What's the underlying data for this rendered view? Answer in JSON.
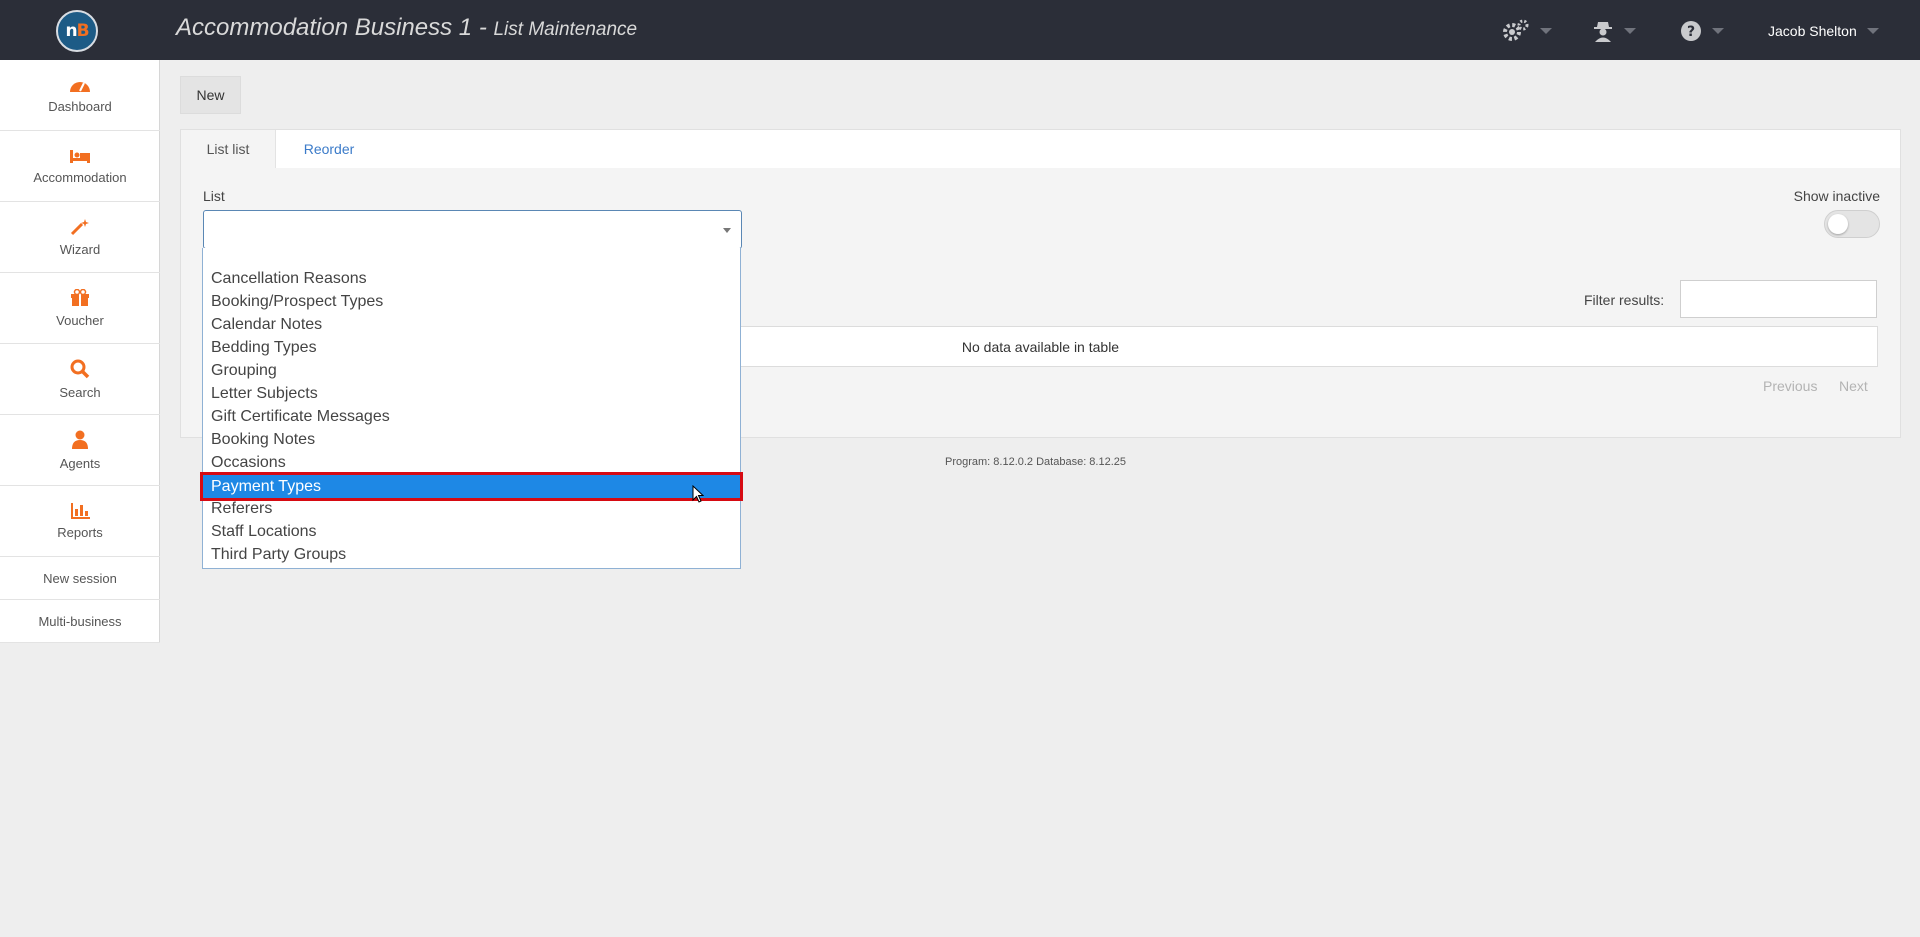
{
  "header": {
    "title": "Accommodation Business 1 - ",
    "subtitle": "List Maintenance",
    "logo_text": "nB",
    "user_name": "Jacob Shelton",
    "icons": [
      "settings-gears-icon",
      "agent-spy-icon",
      "help-icon"
    ]
  },
  "sidebar": {
    "items": [
      {
        "label": "Dashboard",
        "icon": "dashboard-icon"
      },
      {
        "label": "Accommodation",
        "icon": "bed-icon"
      },
      {
        "label": "Wizard",
        "icon": "magic-wand-icon"
      },
      {
        "label": "Voucher",
        "icon": "gift-icon"
      },
      {
        "label": "Search",
        "icon": "search-icon"
      },
      {
        "label": "Agents",
        "icon": "user-icon"
      },
      {
        "label": "Reports",
        "icon": "bar-chart-icon"
      }
    ],
    "links": [
      "New session",
      "Multi-business"
    ]
  },
  "toolbar": {
    "new_label": "New"
  },
  "tabs": [
    {
      "label": "List list",
      "active": true
    },
    {
      "label": "Reorder",
      "active": false
    }
  ],
  "form": {
    "list_label": "List",
    "list_value": "",
    "show_inactive_label": "Show inactive",
    "show_inactive": false,
    "filter_label": "Filter results:",
    "filter_value": ""
  },
  "table": {
    "empty_text": "No data available in table"
  },
  "pager": {
    "previous": "Previous",
    "next": "Next"
  },
  "footer": {
    "version": "Program: 8.12.0.2 Database: 8.12.25"
  },
  "dropdown": {
    "options": [
      "Cancellation Reasons",
      "Booking/Prospect Types",
      "Calendar Notes",
      "Bedding Types",
      "Grouping",
      "Letter Subjects",
      "Gift Certificate Messages",
      "Booking Notes",
      "Occasions",
      "Payment Types",
      "Referers",
      "Staff Locations",
      "Third Party Groups"
    ],
    "highlighted": "Payment Types"
  },
  "colors": {
    "topbar": "#2b2e38",
    "accent": "#f26f21",
    "highlight": "#1e88e5",
    "highlight_border": "#d60a12",
    "link": "#3b7bc9"
  }
}
